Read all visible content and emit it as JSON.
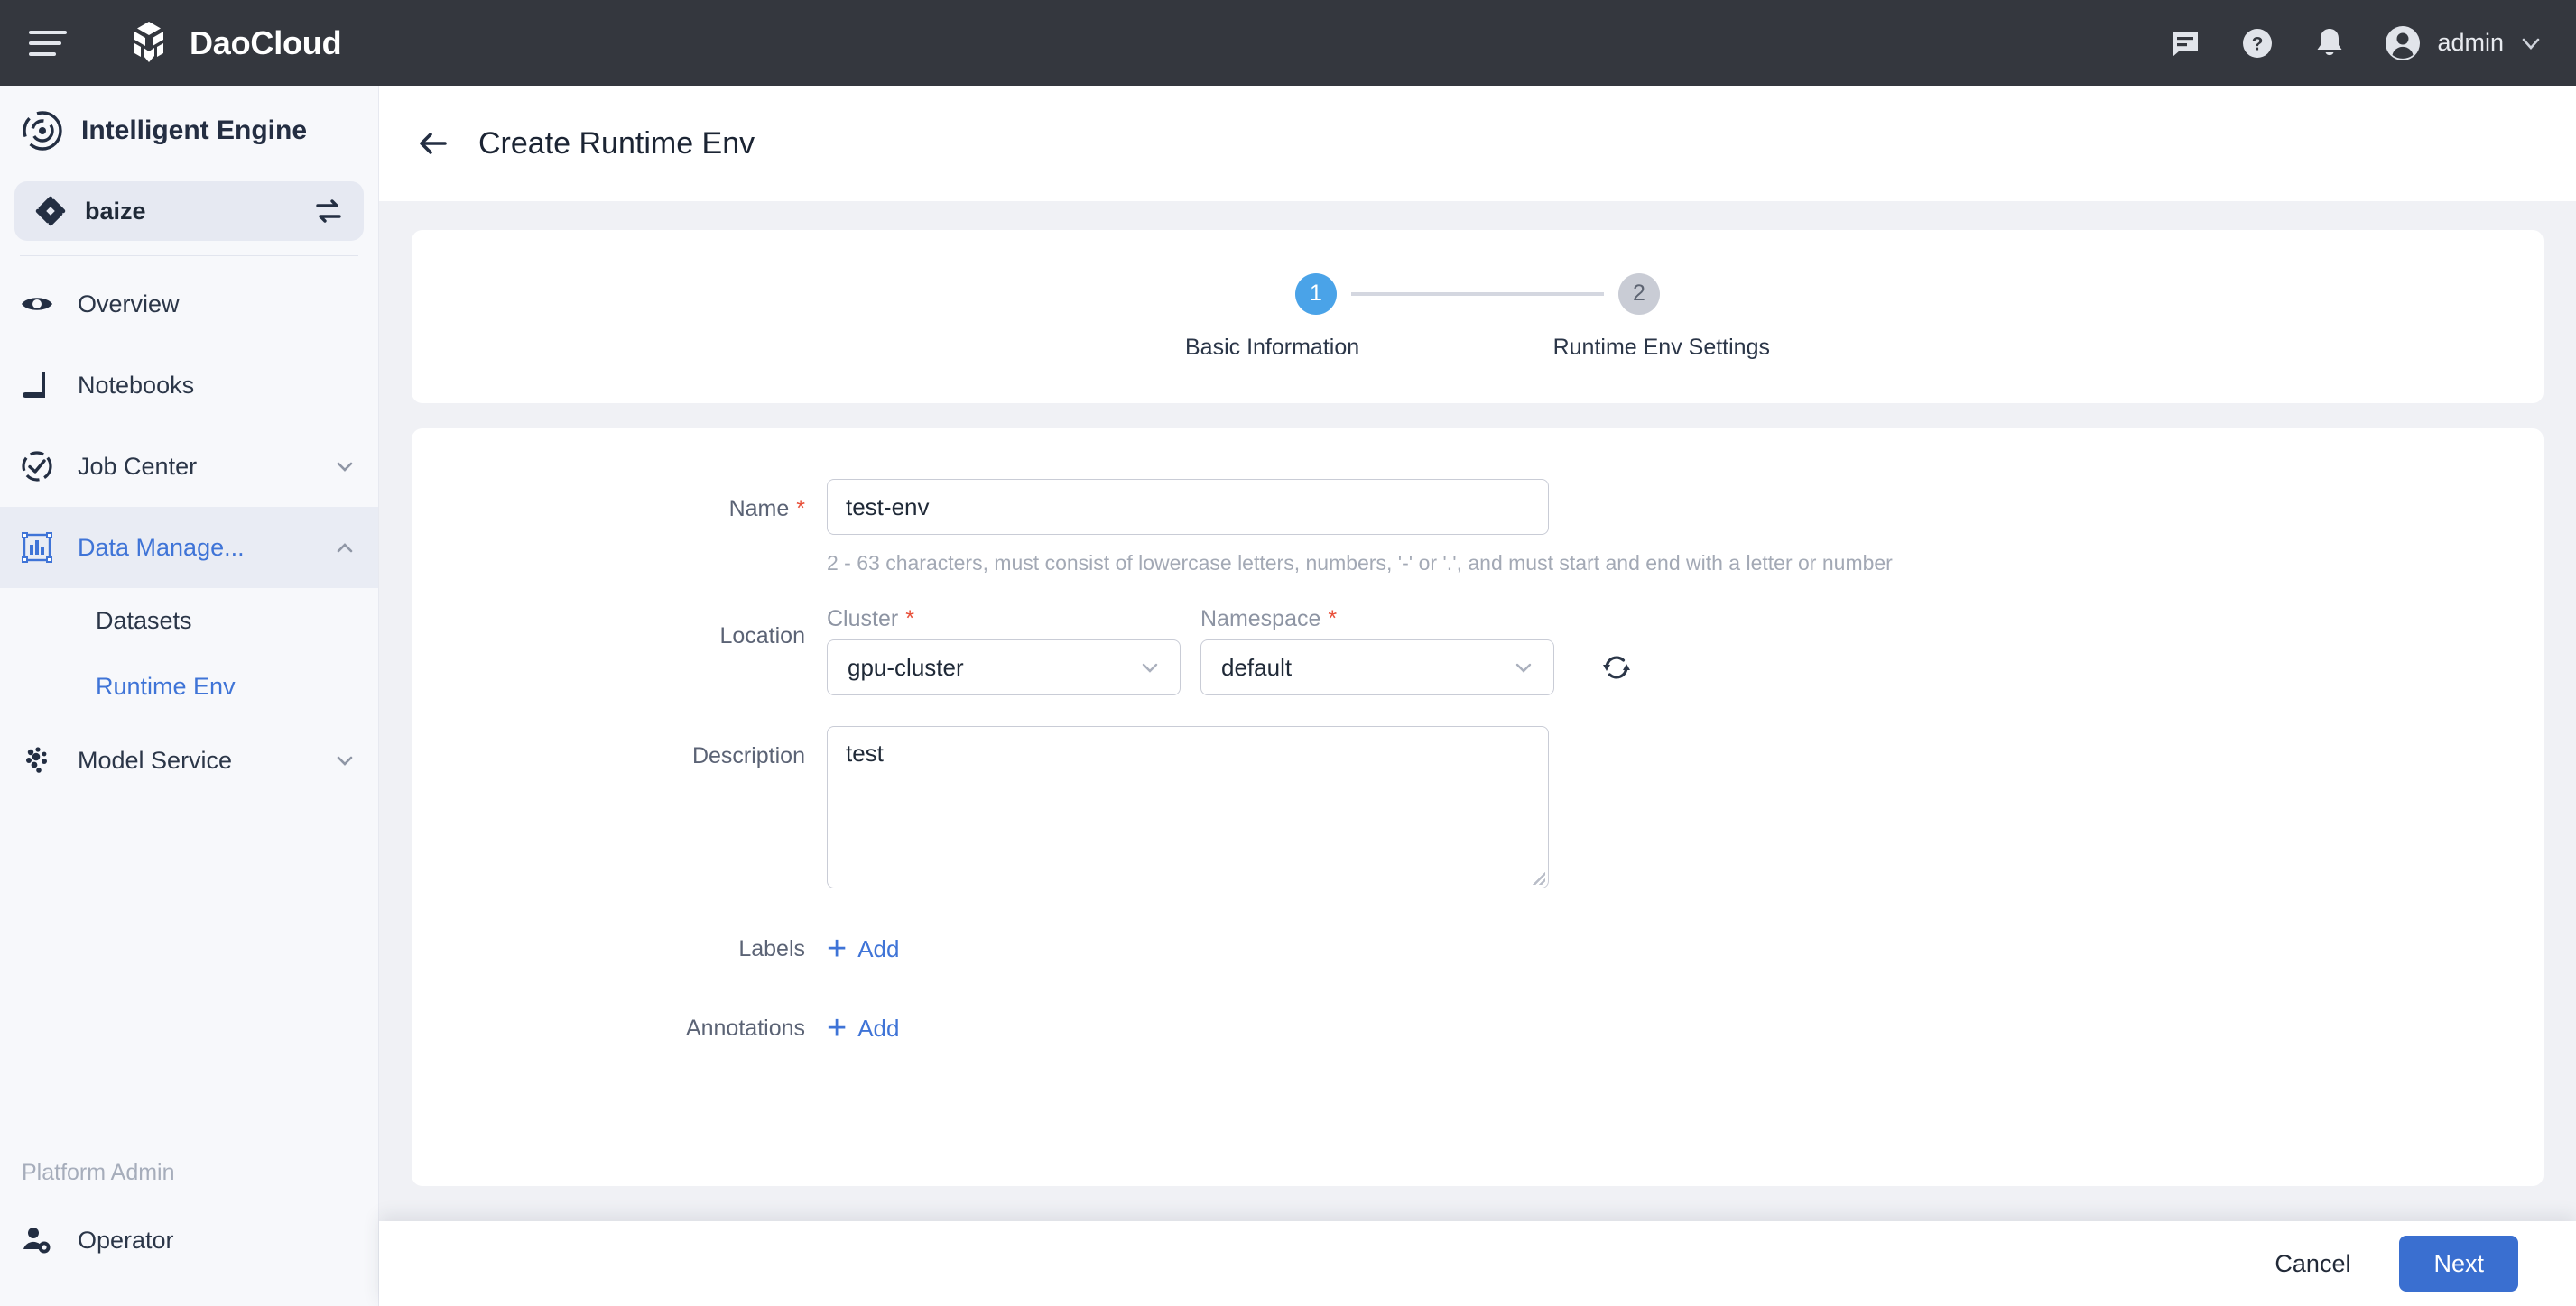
{
  "topbar": {
    "brand": "DaoCloud",
    "menu_icon": "hamburger-icon",
    "logo_icon": "daocloud-cube-logo",
    "icons": [
      "message-icon",
      "help-circle-icon",
      "bell-icon"
    ],
    "user": "admin",
    "user_chevron": "chevron-down-icon"
  },
  "sidebar": {
    "product": "Intelligent Engine",
    "product_icon": "intelligent-engine-icon",
    "workspace": {
      "label": "baize",
      "icon": "workspace-icon",
      "swap_icon": "swap-icon"
    },
    "items": [
      {
        "label": "Overview",
        "icon": "eye-icon",
        "active": false,
        "expandable": false
      },
      {
        "label": "Notebooks",
        "icon": "notebook-icon",
        "active": false,
        "expandable": false
      },
      {
        "label": "Job Center",
        "icon": "check-circle-icon",
        "active": false,
        "expandable": true,
        "chevron": "chevron-down-icon"
      },
      {
        "label": "Data Manage...",
        "icon": "data-chart-icon",
        "active": true,
        "expandable": true,
        "chevron": "chevron-up-icon"
      }
    ],
    "sub_items": [
      {
        "label": "Datasets",
        "active": false
      },
      {
        "label": "Runtime Env",
        "active": true
      }
    ],
    "model_service": {
      "label": "Model Service",
      "icon": "model-service-icon",
      "chevron": "chevron-down-icon"
    },
    "section_label": "Platform Admin",
    "operator": {
      "label": "Operator",
      "icon": "user-gear-icon"
    }
  },
  "page": {
    "title": "Create Runtime Env",
    "back_icon": "arrow-left-icon"
  },
  "stepper": {
    "steps": [
      {
        "number": "1",
        "label": "Basic Information",
        "state": "active"
      },
      {
        "number": "2",
        "label": "Runtime Env Settings",
        "state": "inactive"
      }
    ]
  },
  "form": {
    "name": {
      "label": "Name",
      "required": true,
      "value": "test-env",
      "placeholder": "",
      "hint": "2 - 63 characters, must consist of lowercase letters, numbers, '-' or '.', and must start and end with a letter or number"
    },
    "location": {
      "label": "Location",
      "cluster": {
        "label": "Cluster",
        "required": true,
        "value": "gpu-cluster",
        "chevron": "chevron-down-icon"
      },
      "namespace": {
        "label": "Namespace",
        "required": true,
        "value": "default",
        "chevron": "chevron-down-icon"
      },
      "refresh_icon": "refresh-icon"
    },
    "description": {
      "label": "Description",
      "value": "test",
      "placeholder": ""
    },
    "labels": {
      "label": "Labels",
      "add": "Add",
      "add_icon": "plus-icon"
    },
    "annotations": {
      "label": "Annotations",
      "add": "Add",
      "add_icon": "plus-icon"
    }
  },
  "footer": {
    "cancel": "Cancel",
    "next": "Next"
  },
  "colors": {
    "topbar_bg": "#34373e",
    "accent_blue": "#3a6fd0",
    "link_blue": "#3f74d7",
    "step_active": "#4aa3e8",
    "step_inactive": "#c9ccd5",
    "required_red": "#e8503a",
    "page_bg": "#f0f1f5",
    "sidebar_bg": "#f7f8fb"
  }
}
